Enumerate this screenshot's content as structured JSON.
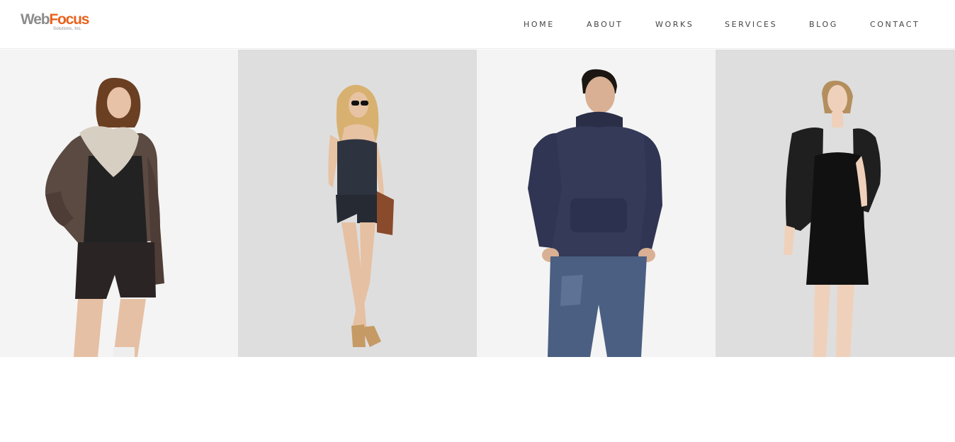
{
  "brand": {
    "logo_web": "Web",
    "logo_focus": "Focus",
    "logo_sub": "Solutions, Inc.",
    "colors": {
      "web": "#8c8c8c",
      "focus": "#e8611c"
    }
  },
  "nav": {
    "items": [
      {
        "label": "HOME"
      },
      {
        "label": "ABOUT"
      },
      {
        "label": "WORKS"
      },
      {
        "label": "SERVICES"
      },
      {
        "label": "BLOG"
      },
      {
        "label": "CONTACT"
      }
    ]
  },
  "gallery": {
    "tiles": [
      {
        "subject": "woman-leather-jacket-scarf",
        "background": "#f4f4f4"
      },
      {
        "subject": "woman-corset-romper-sunglasses",
        "background": "#dedede"
      },
      {
        "subject": "man-knit-sweater-jeans",
        "background": "#f4f4f4"
      },
      {
        "subject": "woman-black-dress-jacket",
        "background": "#dedede"
      }
    ]
  }
}
